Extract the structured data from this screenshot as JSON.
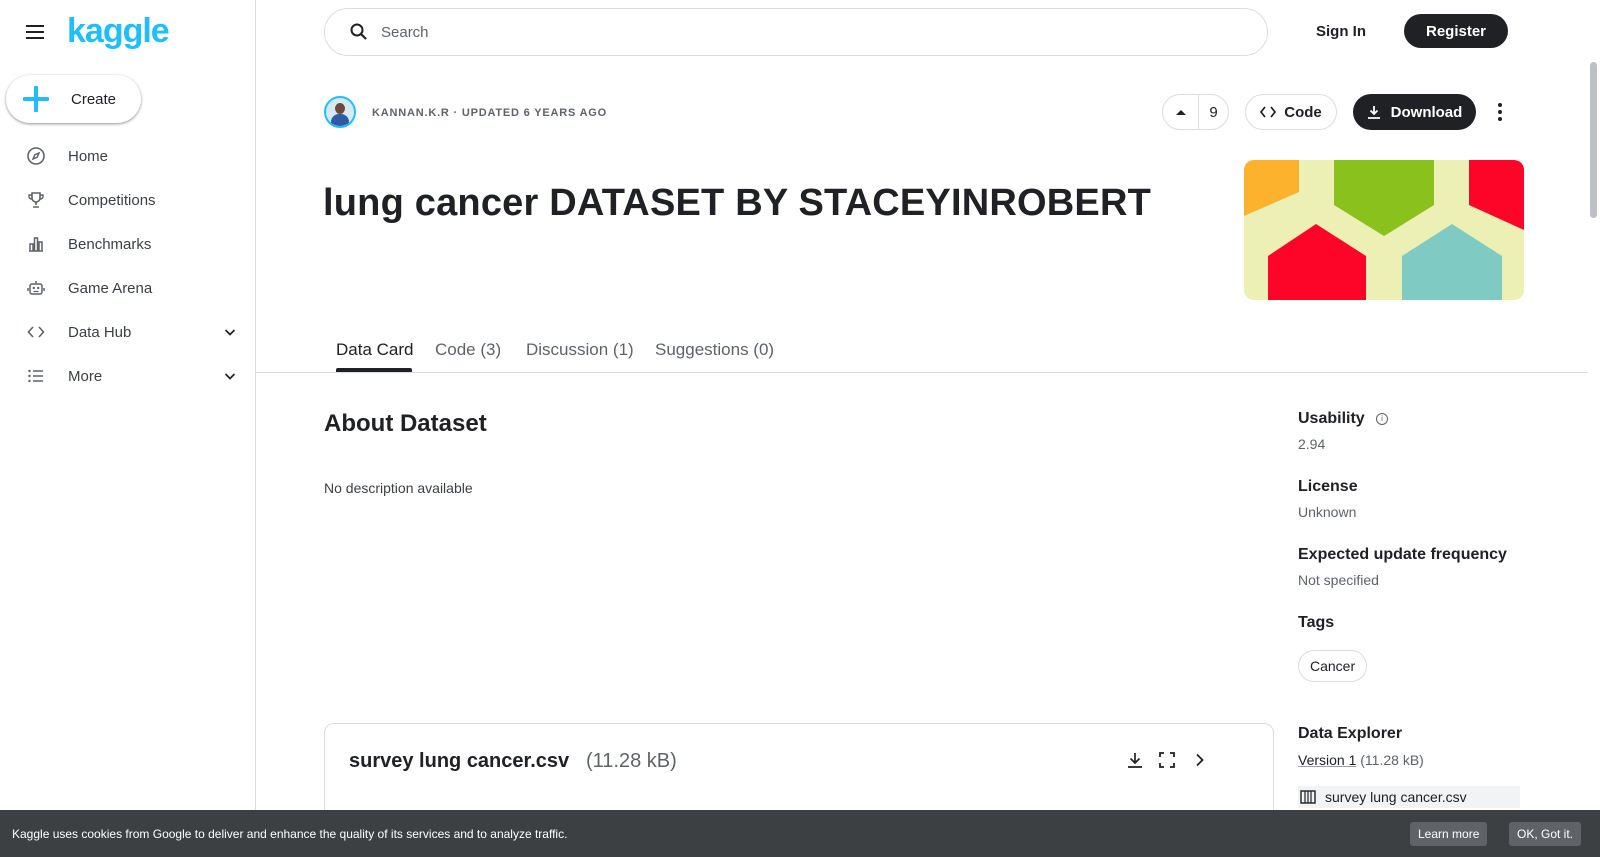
{
  "app": {
    "logo_text": "kaggle",
    "brand_color": "#20beff"
  },
  "sidebar": {
    "create_label": "Create",
    "items": [
      {
        "label": "Home",
        "icon": "compass-icon"
      },
      {
        "label": "Competitions",
        "icon": "trophy-icon"
      },
      {
        "label": "Benchmarks",
        "icon": "bar-chart-icon"
      },
      {
        "label": "Game Arena",
        "icon": "robot-icon"
      },
      {
        "label": "Data Hub",
        "icon": "code-icon",
        "expandable": true
      },
      {
        "label": "More",
        "icon": "list-icon",
        "expandable": true
      }
    ]
  },
  "topbar": {
    "search_placeholder": "Search",
    "signin_label": "Sign In",
    "register_label": "Register"
  },
  "dataset": {
    "meta": "KANNAN.K.R · UPDATED 6 YEARS AGO",
    "vote_count": "9",
    "code_label": "Code",
    "download_label": "Download",
    "title": "lung cancer DATASET BY STACEYINROBERT",
    "tabs": [
      {
        "label": "Data Card",
        "active": true
      },
      {
        "label": "Code (3)"
      },
      {
        "label": "Discussion (1)"
      },
      {
        "label": "Suggestions (0)"
      }
    ],
    "about_heading": "About Dataset",
    "description": "No description available"
  },
  "file_card": {
    "name": "survey lung cancer.csv",
    "size": "(11.28 kB)"
  },
  "side_panel": {
    "usability_label": "Usability",
    "usability_value": "2.94",
    "license_label": "License",
    "license_value": "Unknown",
    "frequency_label": "Expected update frequency",
    "frequency_value": "Not specified",
    "tags_label": "Tags",
    "tags": [
      "Cancer"
    ],
    "explorer_label": "Data Explorer",
    "version_label": "Version 1",
    "version_size": "(11.28 kB)",
    "explorer_file": "survey lung cancer.csv"
  },
  "cookie": {
    "text": "Kaggle uses cookies from Google to deliver and enhance the quality of its services and to analyze traffic.",
    "learn_more": "Learn more",
    "ok": "OK, Got it."
  }
}
